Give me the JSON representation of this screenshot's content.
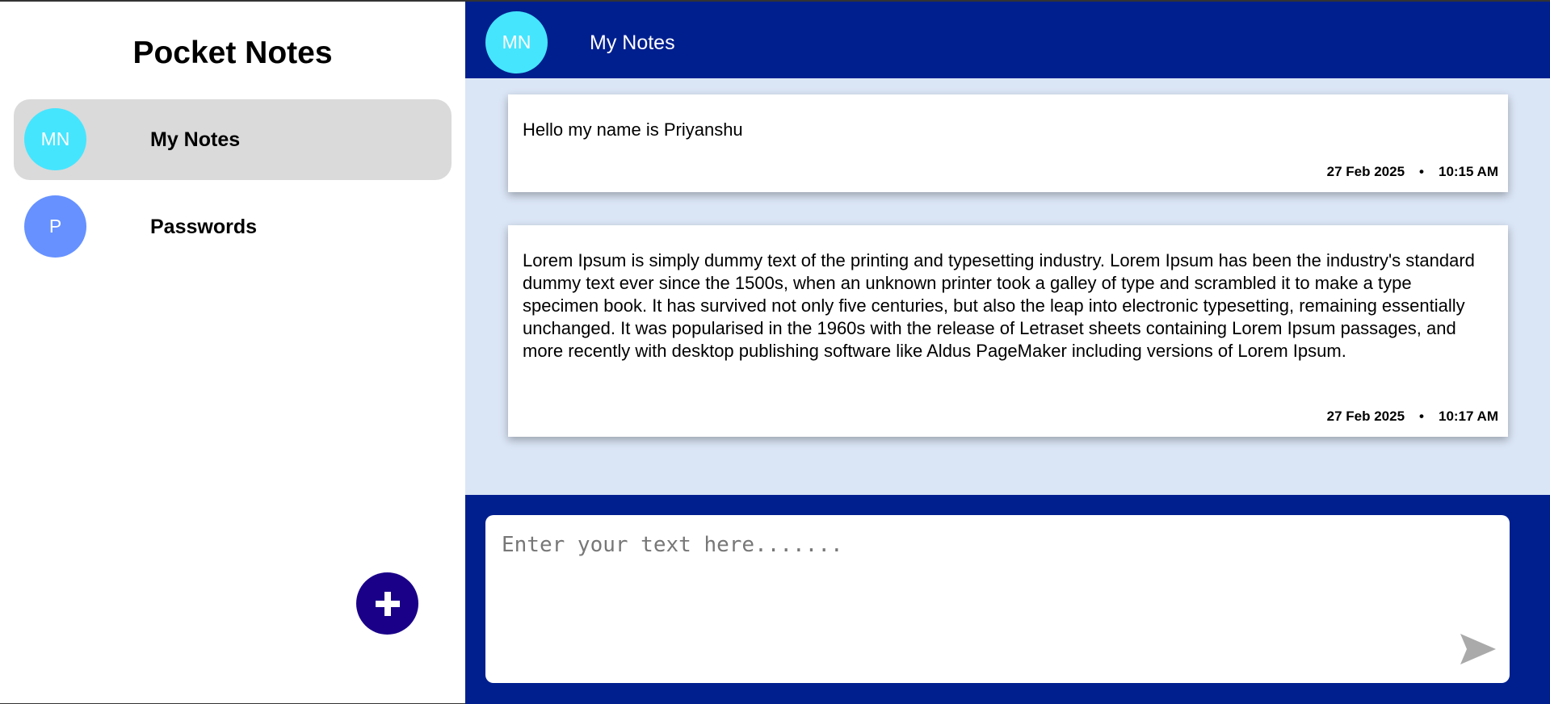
{
  "app_title": "Pocket Notes",
  "groups": [
    {
      "initials": "MN",
      "name": "My Notes",
      "color": "#45e5fe",
      "active": true
    },
    {
      "initials": "P",
      "name": "Passwords",
      "color": "#6691ff",
      "active": false
    }
  ],
  "add_button_icon": "plus-icon",
  "header": {
    "initials": "MN",
    "title": "My Notes",
    "avatar_color": "#45e5fe"
  },
  "notes": [
    {
      "text": "Hello my name is Priyanshu",
      "date": "27 Feb 2025",
      "separator": "•",
      "time": "10:15 AM"
    },
    {
      "text": "Lorem Ipsum is simply dummy text of the printing and typesetting industry. Lorem Ipsum has been the industry's standard dummy text ever since the 1500s, when an unknown printer took a galley of type and scrambled it to make a type specimen book. It has survived not only five centuries, but also the leap into electronic typesetting, remaining essentially unchanged. It was popularised in the 1960s with the release of Letraset sheets containing Lorem Ipsum passages, and more recently with desktop publishing software like Aldus PageMaker including versions of Lorem Ipsum.",
      "date": "27 Feb 2025",
      "separator": "•",
      "time": "10:17 AM"
    }
  ],
  "composer": {
    "placeholder": "Enter your text here.......",
    "value": "",
    "send_icon": "send-icon"
  },
  "colors": {
    "header_bg": "#001f8e",
    "main_bg": "#dae5f5",
    "add_button_bg": "#1a0088",
    "active_item_bg": "#dadada",
    "send_icon": "#aaaaaa"
  }
}
